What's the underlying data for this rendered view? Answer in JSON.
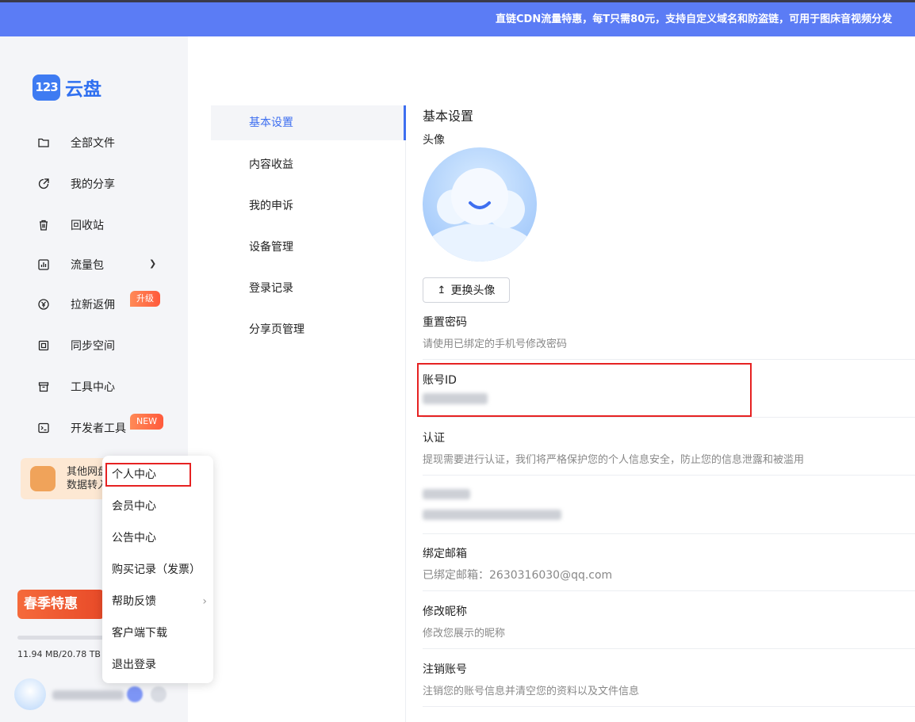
{
  "banner": {
    "text": "直链CDN流量特惠，每T只需80元，支持自定义域名和防盗链，可用于图床音视频分发"
  },
  "logo": {
    "badge": "123",
    "name": "云盘"
  },
  "sidebar": {
    "items": [
      {
        "label": "全部文件",
        "icon": "folder-icon"
      },
      {
        "label": "我的分享",
        "icon": "share-icon"
      },
      {
        "label": "回收站",
        "icon": "trash-icon"
      },
      {
        "label": "流量包",
        "icon": "traffic-icon"
      },
      {
        "label": "拉新返佣",
        "icon": "yen-icon"
      },
      {
        "label": "同步空间",
        "icon": "sync-icon"
      },
      {
        "label": "工具中心",
        "icon": "toolbox-icon"
      },
      {
        "label": "开发者工具",
        "icon": "terminal-icon"
      }
    ],
    "badge_upgrade": "升级",
    "badge_new": "NEW",
    "promo_line1": "其他网盘",
    "promo_line2": "数据转入",
    "spring_sale": "春季特惠",
    "storage": "11.94 MB/20.78 TB",
    "storage_fraction": 0.0
  },
  "popup_menu": {
    "items": [
      "个人中心",
      "会员中心",
      "公告中心",
      "购买记录（发票）",
      "帮助反馈",
      "客户端下载",
      "退出登录"
    ],
    "help_arrow": "›"
  },
  "subnav": {
    "items": [
      "基本设置",
      "内容收益",
      "我的申诉",
      "设备管理",
      "登录记录",
      "分享页管理"
    ],
    "active": "基本设置"
  },
  "settings": {
    "title": "基本设置",
    "avatar_label": "头像",
    "change_avatar": "更换头像",
    "reset_password": "重置密码",
    "reset_password_desc": "请使用已绑定的手机号修改密码",
    "account_id": "账号ID",
    "verify": "认证",
    "verify_desc": "提现需要进行认证，我们将严格保护您的个人信息安全，防止您的信息泄露和被滥用",
    "email": "绑定邮箱",
    "email_desc": "已绑定邮箱：2630316030@qq.com",
    "nickname": "修改昵称",
    "nickname_desc": "修改您展示的昵称",
    "cancel": "注销账号",
    "cancel_desc": "注销您的账号信息并清空您的资料以及文件信息"
  },
  "colors": {
    "accent": "#3e6ff0",
    "banner": "#5b7cf5",
    "highlight": "#e62222"
  }
}
